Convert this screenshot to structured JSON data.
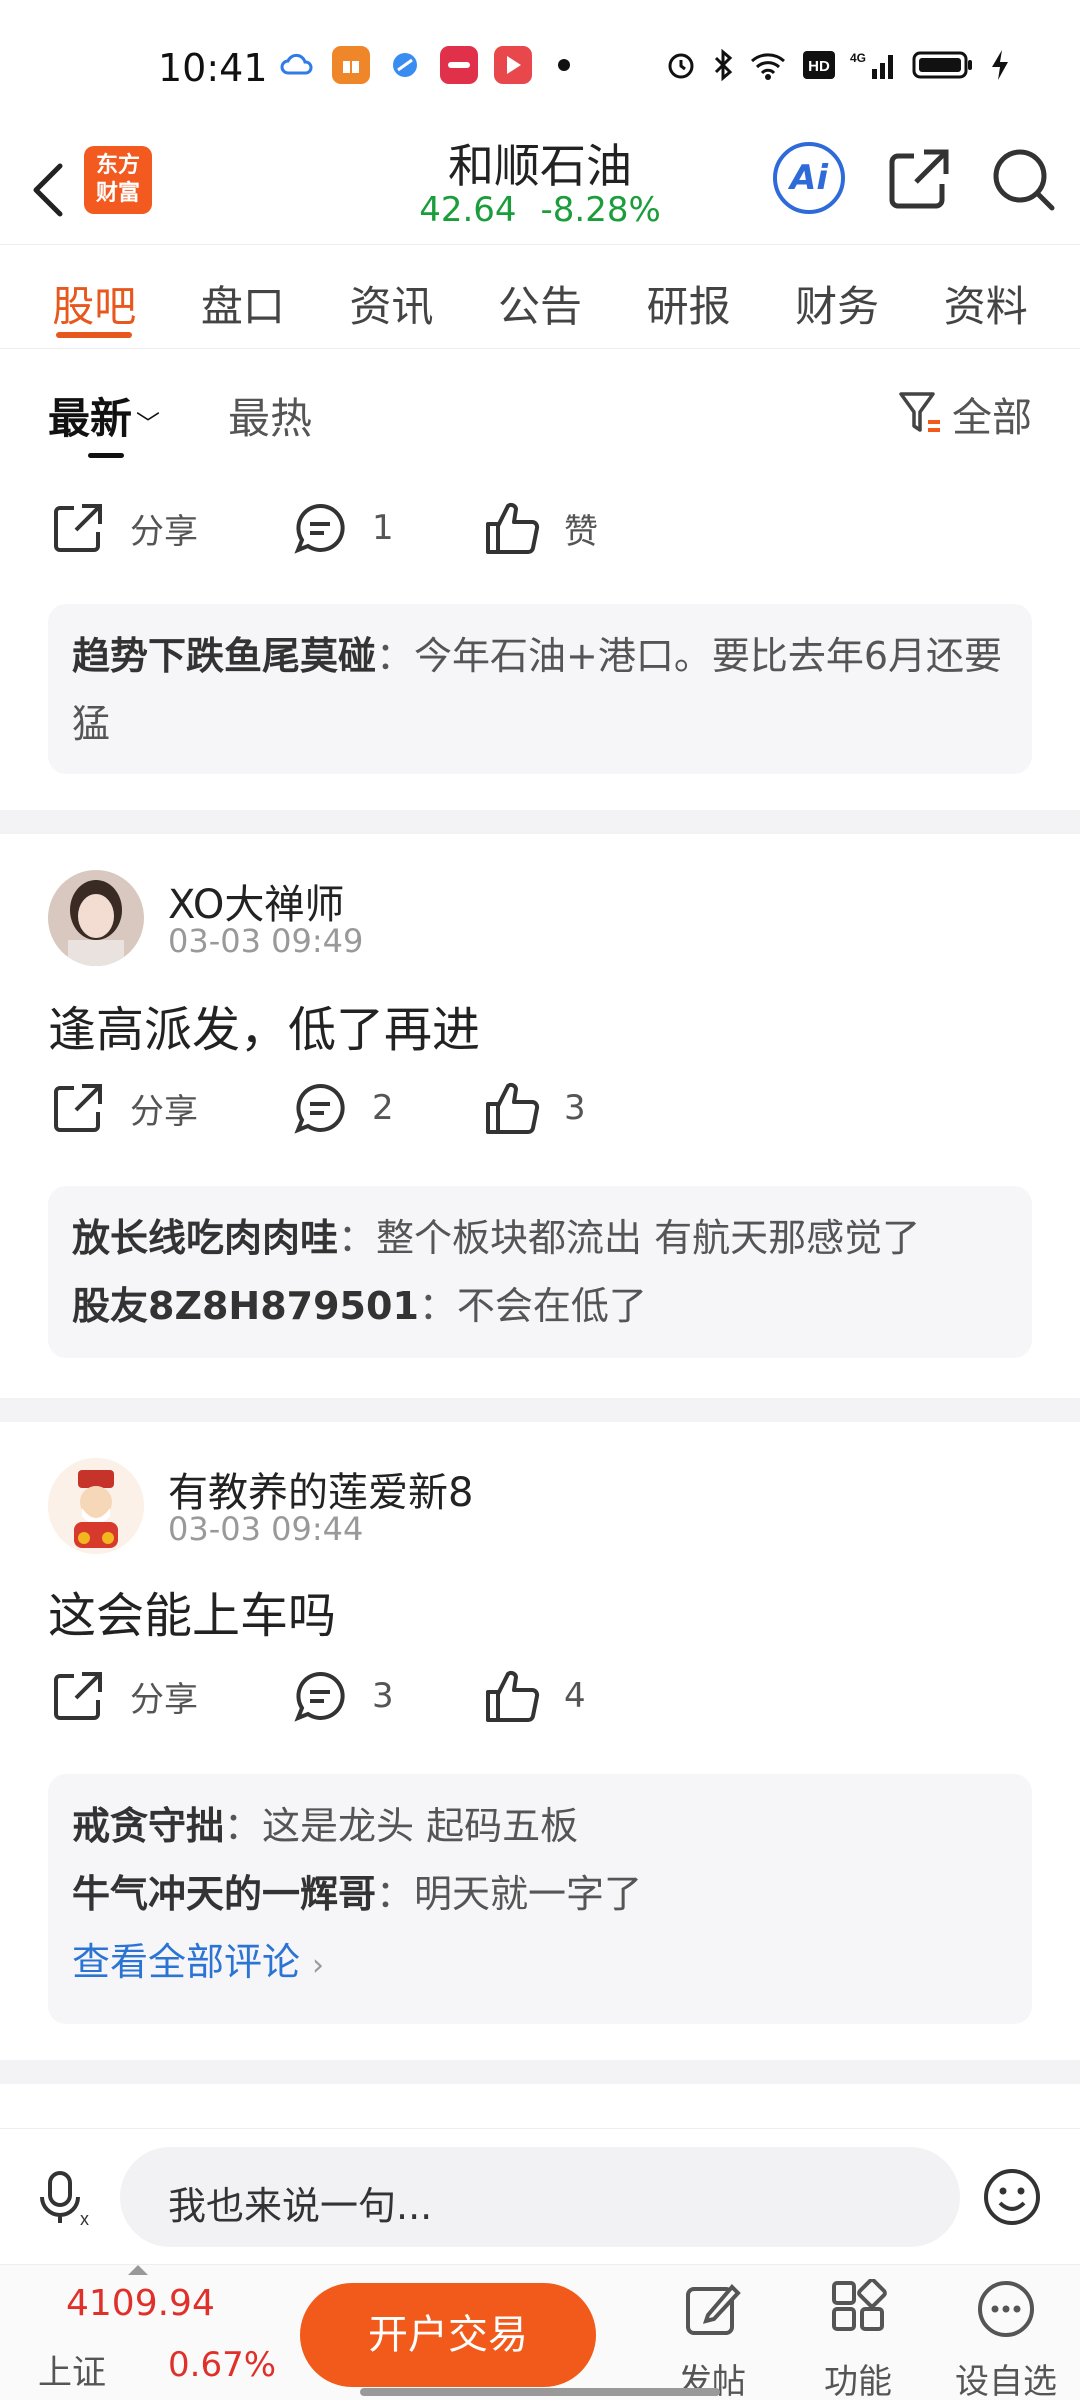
{
  "status": {
    "time": "10:41"
  },
  "header": {
    "logo_text_line1": "东方",
    "logo_text_line2": "财富",
    "stock_name": "和顺石油",
    "price": "42.64",
    "change": "-8.28%",
    "ai_label": "Ai"
  },
  "tabs": [
    "股吧",
    "盘口",
    "资讯",
    "公告",
    "研报",
    "财务",
    "资料"
  ],
  "sort": {
    "newest": "最新",
    "hot": "最热",
    "filter": "全部"
  },
  "post0": {
    "share": "分享",
    "comments": "1",
    "like": "赞",
    "replies": [
      {
        "author": "趋势下跌鱼尾莫碰",
        "text": "：今年石油+港口。要比去年6月还要猛"
      }
    ]
  },
  "post1": {
    "user": "XO大禅师",
    "time": "03-03 09:49",
    "text": "逢高派发，低了再进",
    "share": "分享",
    "comments": "2",
    "likes": "3",
    "replies": [
      {
        "author": "放长线吃肉肉哇",
        "text": "：整个板块都流出 有航天那感觉了"
      },
      {
        "author": "股友8Z8H879501",
        "text": "：不会在低了"
      }
    ]
  },
  "post2": {
    "user": "有教养的莲爱新8",
    "time": "03-03 09:44",
    "text": "这会能上车吗",
    "share": "分享",
    "comments": "3",
    "likes": "4",
    "replies": [
      {
        "author": "戒贪守拙",
        "text": "：这是龙头 起码五板"
      },
      {
        "author": "牛气冲天的一辉哥",
        "text": "：明天就一字了"
      }
    ],
    "view_all": "查看全部评论"
  },
  "input": {
    "placeholder": "我也来说一句..."
  },
  "bottom": {
    "index_value": "4109.94",
    "index_name": "上证",
    "index_change": "0.67%",
    "open_account": "开户交易",
    "post": "发帖",
    "functions": "功能",
    "watchlist": "设自选"
  },
  "colors": {
    "accent": "#e8571e",
    "down": "#1a9d3a",
    "up": "#e0302a",
    "link": "#2c74d4"
  }
}
